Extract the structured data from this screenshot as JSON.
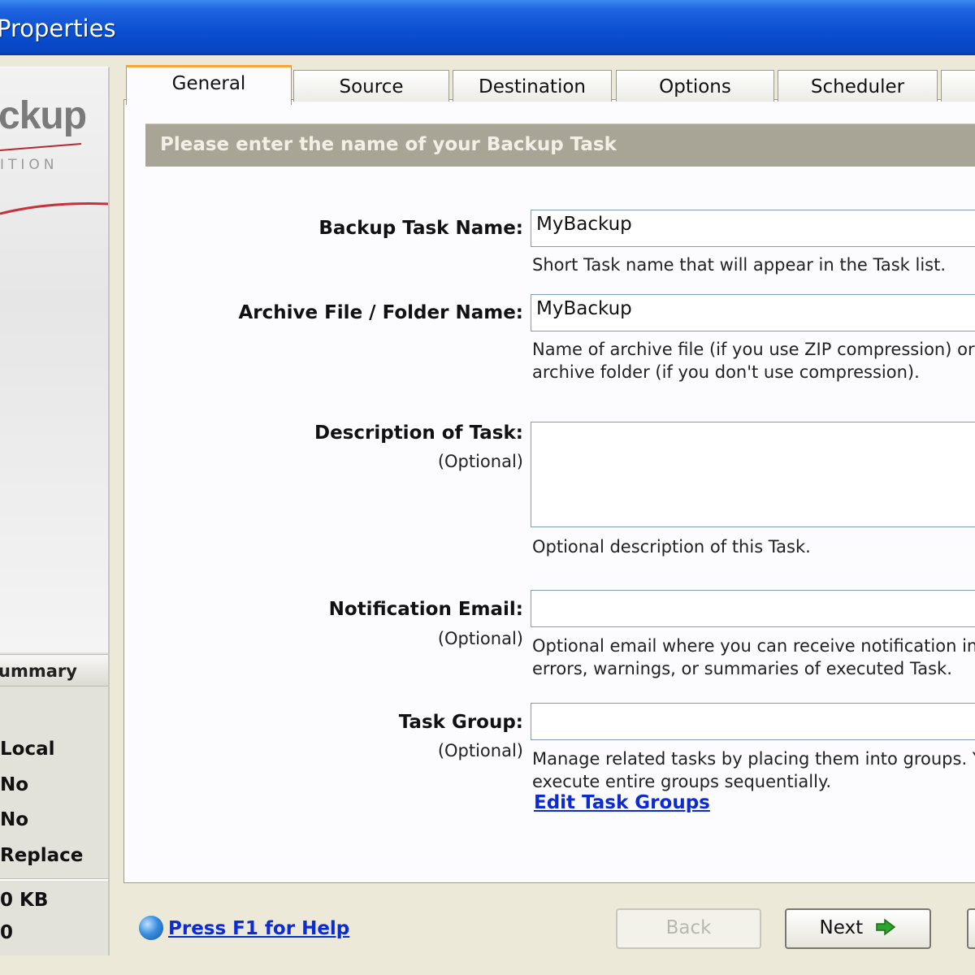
{
  "window": {
    "title": "Properties"
  },
  "brand": {
    "logo_text": "ckup",
    "edition_text": "ITION"
  },
  "summary": {
    "header": "ummary",
    "values": [
      "Local",
      "No",
      "No",
      "Replace"
    ],
    "size": "0 KB",
    "count": "0"
  },
  "tabs": [
    "General",
    "Source",
    "Destination",
    "Options",
    "Scheduler"
  ],
  "active_tab": "General",
  "section_header": "Please enter the name of your Backup Task",
  "form": {
    "task_name": {
      "label": "Backup Task Name:",
      "value": "MyBackup",
      "hint": "Short Task name that will appear in the Task list."
    },
    "archive_name": {
      "label": "Archive File / Folder Name:",
      "value": "MyBackup",
      "hint_line1": "Name of archive file (if you use ZIP compression) or na",
      "hint_line2": "archive folder (if you don't use compression)."
    },
    "description": {
      "label": "Description of Task:",
      "optional": "(Optional)",
      "value": "",
      "hint": "Optional description of this Task."
    },
    "email": {
      "label": "Notification Email:",
      "optional": "(Optional)",
      "value": "",
      "hint_line1": "Optional email where you can receive notification in c",
      "hint_line2": "errors, warnings, or summaries of executed Task."
    },
    "group": {
      "label": "Task Group:",
      "optional": "(Optional)",
      "value": "",
      "hint_line1": "Manage related tasks by placing them into groups. Yo",
      "hint_line2": "execute entire groups sequentially.",
      "link": "Edit Task Groups"
    }
  },
  "footer": {
    "help_link": "Press F1 for Help",
    "back_label": "Back",
    "next_label": "Next"
  },
  "colors": {
    "titlebar": "#0a4fd1",
    "tab_accent": "#f3a83c",
    "header_band": "#a9a596",
    "link": "#0b2bd6",
    "next_arrow": "#2fa32a"
  }
}
